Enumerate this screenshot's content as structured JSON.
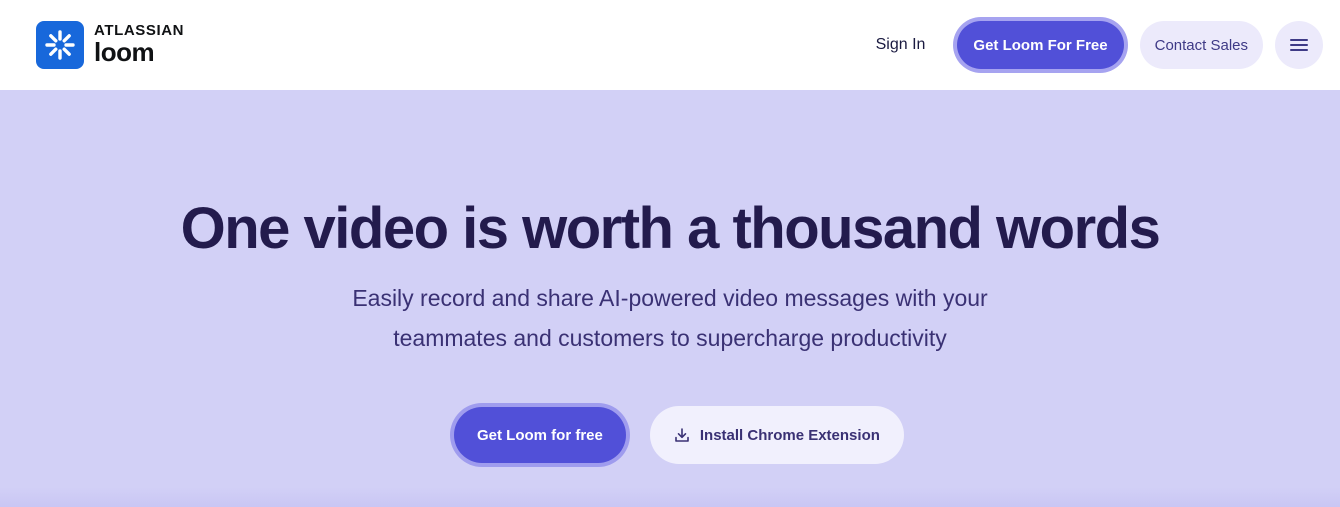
{
  "header": {
    "logo": {
      "brand": "ATLASSIAN",
      "product": "loom",
      "icon": "loom-logo-icon"
    },
    "nav": {
      "sign_in": "Sign In",
      "get_loom": "Get Loom For Free",
      "contact_sales": "Contact Sales",
      "menu_icon": "hamburger-menu-icon"
    }
  },
  "hero": {
    "title": "One video is worth a thousand words",
    "subtitle_line1": "Easily record and share AI-powered video messages with your",
    "subtitle_line2": "teammates and customers to supercharge productivity",
    "primary_cta": "Get Loom for free",
    "secondary_cta": "Install Chrome Extension",
    "secondary_icon": "download-icon"
  },
  "colors": {
    "brand_blue": "#1868db",
    "accent_purple": "#5150d8",
    "hero_background": "#d2d0f6",
    "heading_text": "#231b4d"
  }
}
